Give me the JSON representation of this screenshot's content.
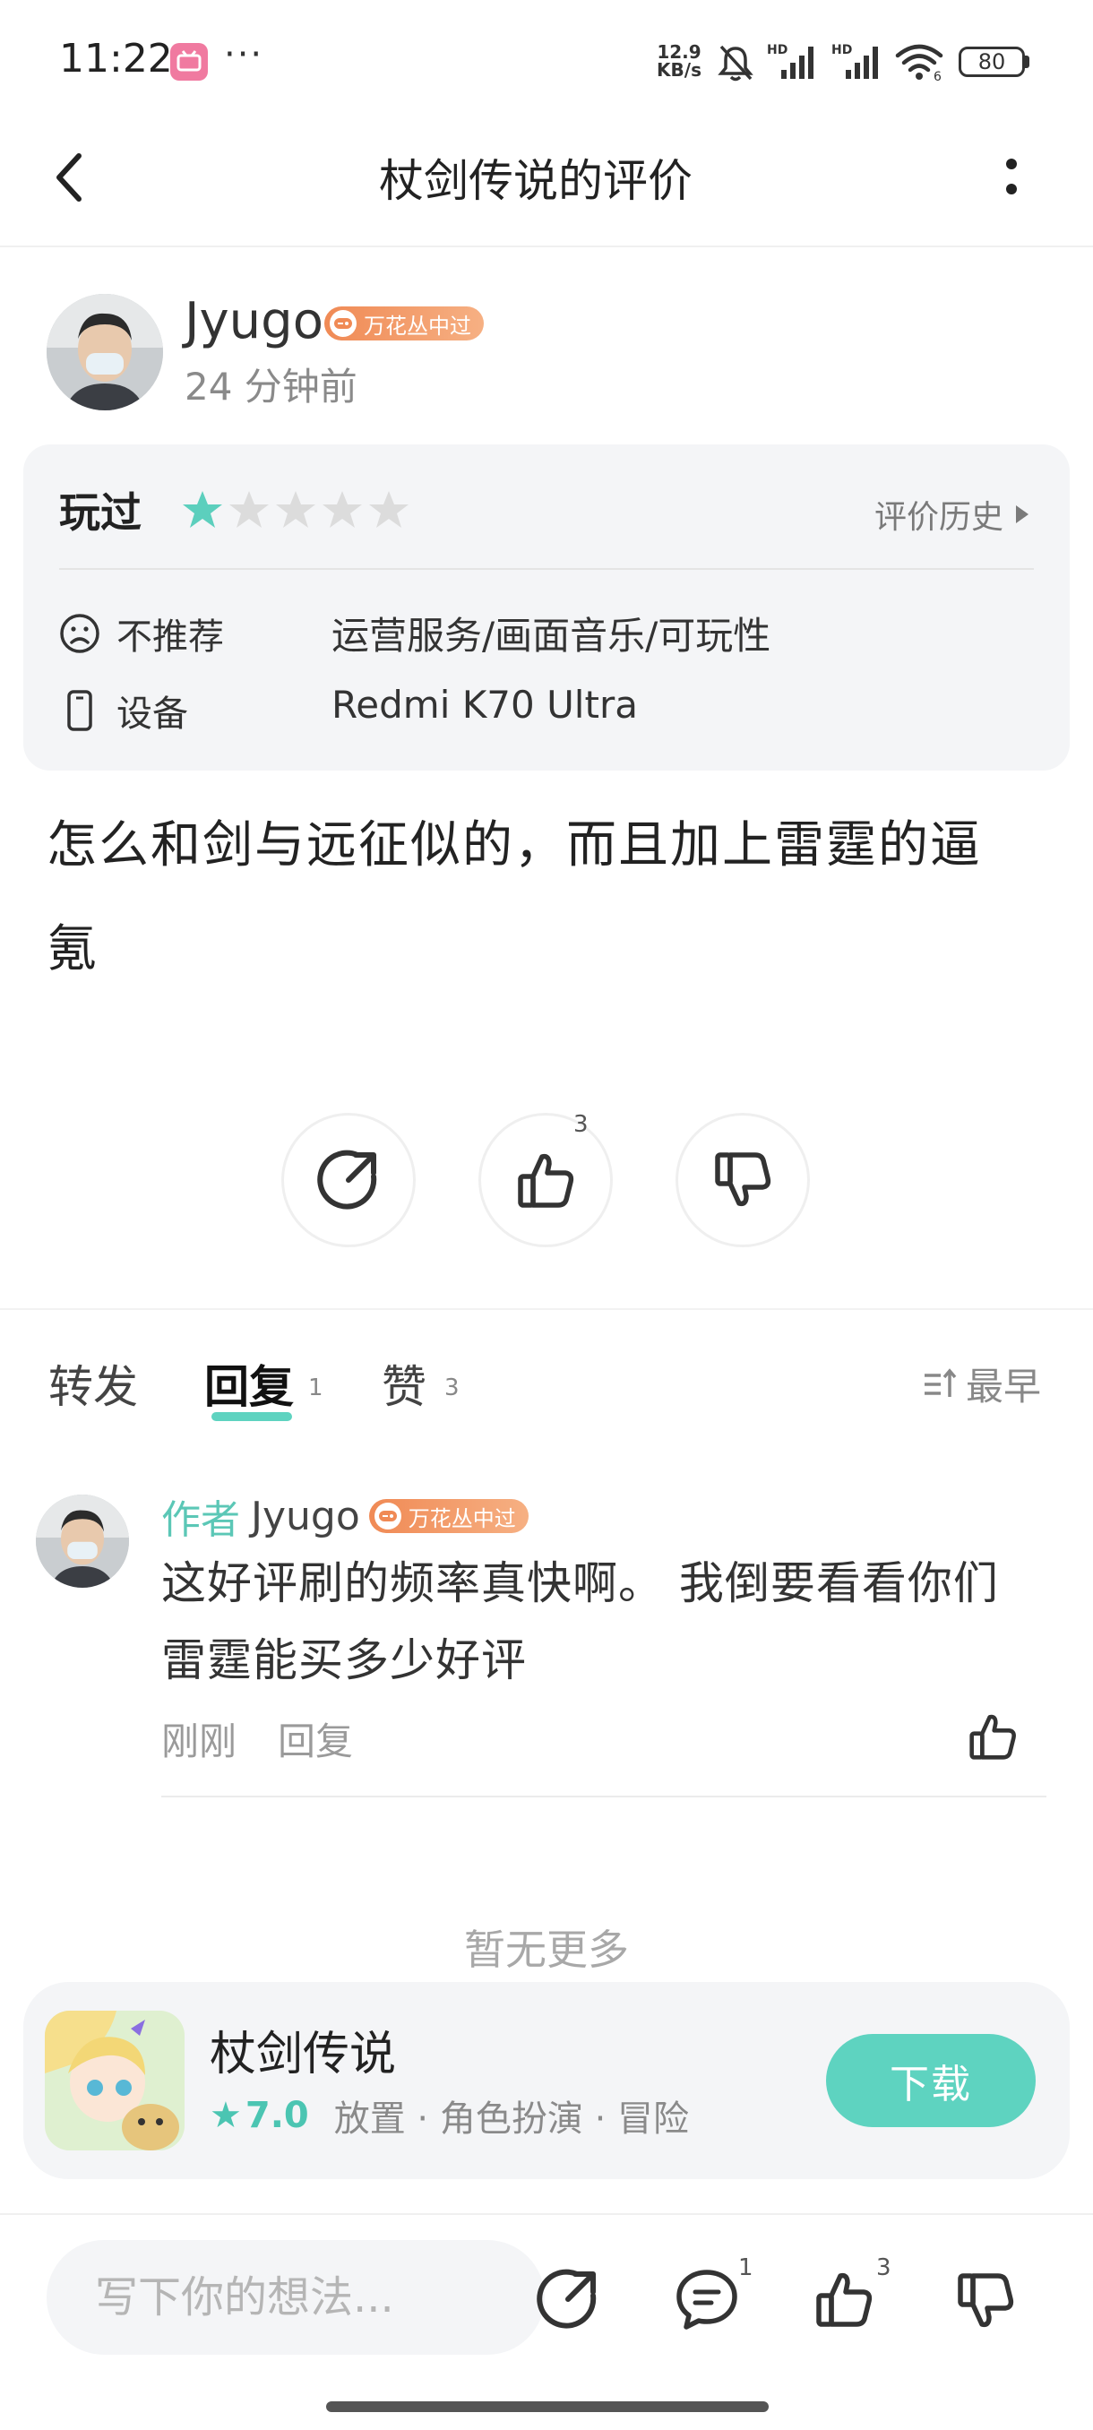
{
  "status_bar": {
    "time": "11:22",
    "dots": "···",
    "net_speed_value": "12.9",
    "net_speed_unit": "KB/s",
    "battery": "80",
    "app_icon": "bilibili-app-icon"
  },
  "header": {
    "title": "杖剑传说的评价",
    "back_icon": "back-arrow-icon",
    "more_icon": "more-vertical-icon"
  },
  "review": {
    "author": "Jyugo",
    "badge": "万花丛中过",
    "time": "24 分钟前",
    "played_label": "玩过",
    "stars_filled": 1,
    "stars_total": 5,
    "history_link": "评价历史",
    "not_recommend_label": "不推荐",
    "not_recommend_value": "运营服务/画面音乐/可玩性",
    "device_label": "设备",
    "device_value": "Redmi K70 Ultra",
    "content_line1": "怎么和剑与远征似的，而且加上雷霆的逼",
    "content_line2": "氪",
    "like_count": "3"
  },
  "tabs": {
    "items": [
      {
        "label": "转发",
        "count": ""
      },
      {
        "label": "回复",
        "count": "1"
      },
      {
        "label": "赞",
        "count": "3"
      }
    ],
    "active": 1,
    "sort_label": "最早"
  },
  "reply": {
    "author_tag": "作者",
    "author": "Jyugo",
    "badge": "万花丛中过",
    "line1": "这好评刷的频率真快啊。 我倒要看看你们",
    "line2": "雷霆能买多少好评",
    "time": "刚刚",
    "reply_action": "回复"
  },
  "no_more": "暂无更多",
  "game": {
    "name": "杖剑传说",
    "rating_star": "★",
    "rating": "7.0",
    "tags": "放置 · 角色扮演 · 冒险",
    "download": "下载"
  },
  "bottom_bar": {
    "placeholder": "写下你的想法...",
    "comment_count": "1",
    "like_count": "3"
  },
  "colors": {
    "accent": "#5ed3c0",
    "badge": "#f08a55",
    "star_filled": "#5ccfbd",
    "star_empty": "#dcdcdc"
  }
}
